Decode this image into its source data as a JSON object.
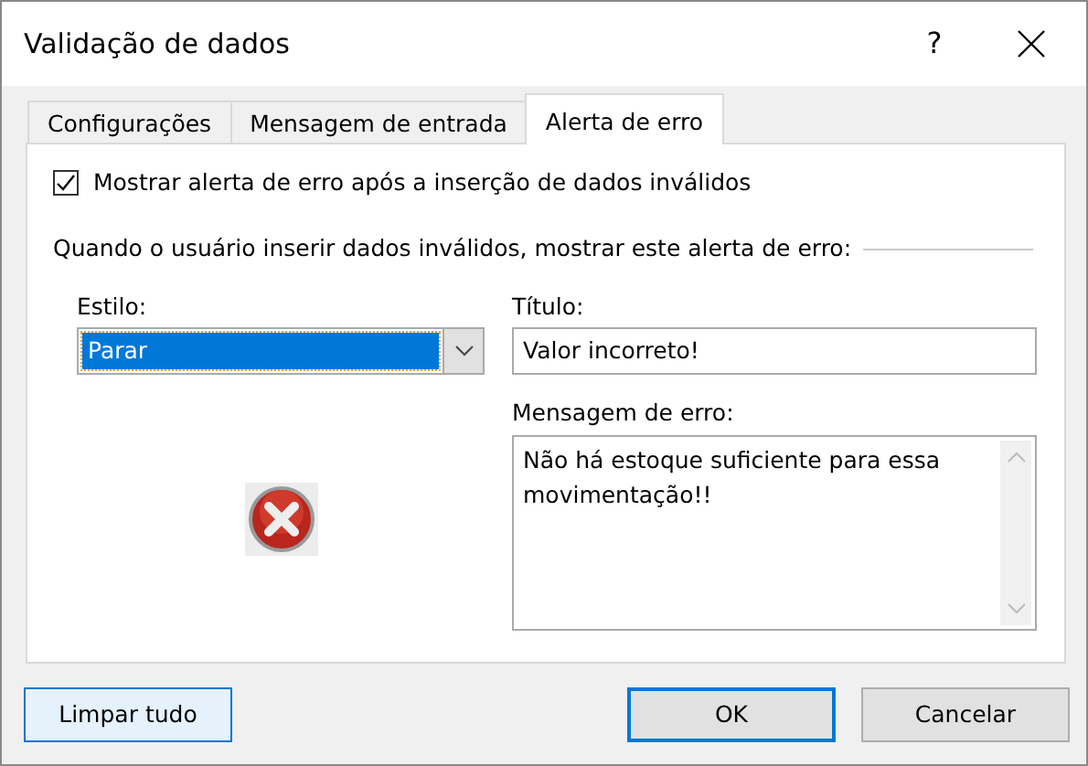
{
  "window": {
    "title": "Validação de dados",
    "help": "?"
  },
  "tabs": [
    {
      "label": "Configurações",
      "selected": false
    },
    {
      "label": "Mensagem de entrada",
      "selected": false
    },
    {
      "label": "Alerta de erro",
      "selected": true
    }
  ],
  "show_alert": {
    "label": "Mostrar alerta de erro após a inserção de dados inválidos",
    "checked": true
  },
  "section_label": "Quando o usuário inserir dados inválidos, mostrar este alerta de erro:",
  "style": {
    "label": "Estilo:",
    "value": "Parar"
  },
  "title_field": {
    "label": "Título:",
    "value": "Valor incorreto!"
  },
  "message_field": {
    "label": "Mensagem de erro:",
    "value": "Não há estoque suficiente para essa movimentação!!"
  },
  "buttons": [
    {
      "label": "Limpar tudo",
      "hovered": true,
      "default": false
    },
    {
      "label": "OK",
      "hovered": false,
      "default": true
    },
    {
      "label": "Cancelar",
      "hovered": false,
      "default": false
    }
  ]
}
